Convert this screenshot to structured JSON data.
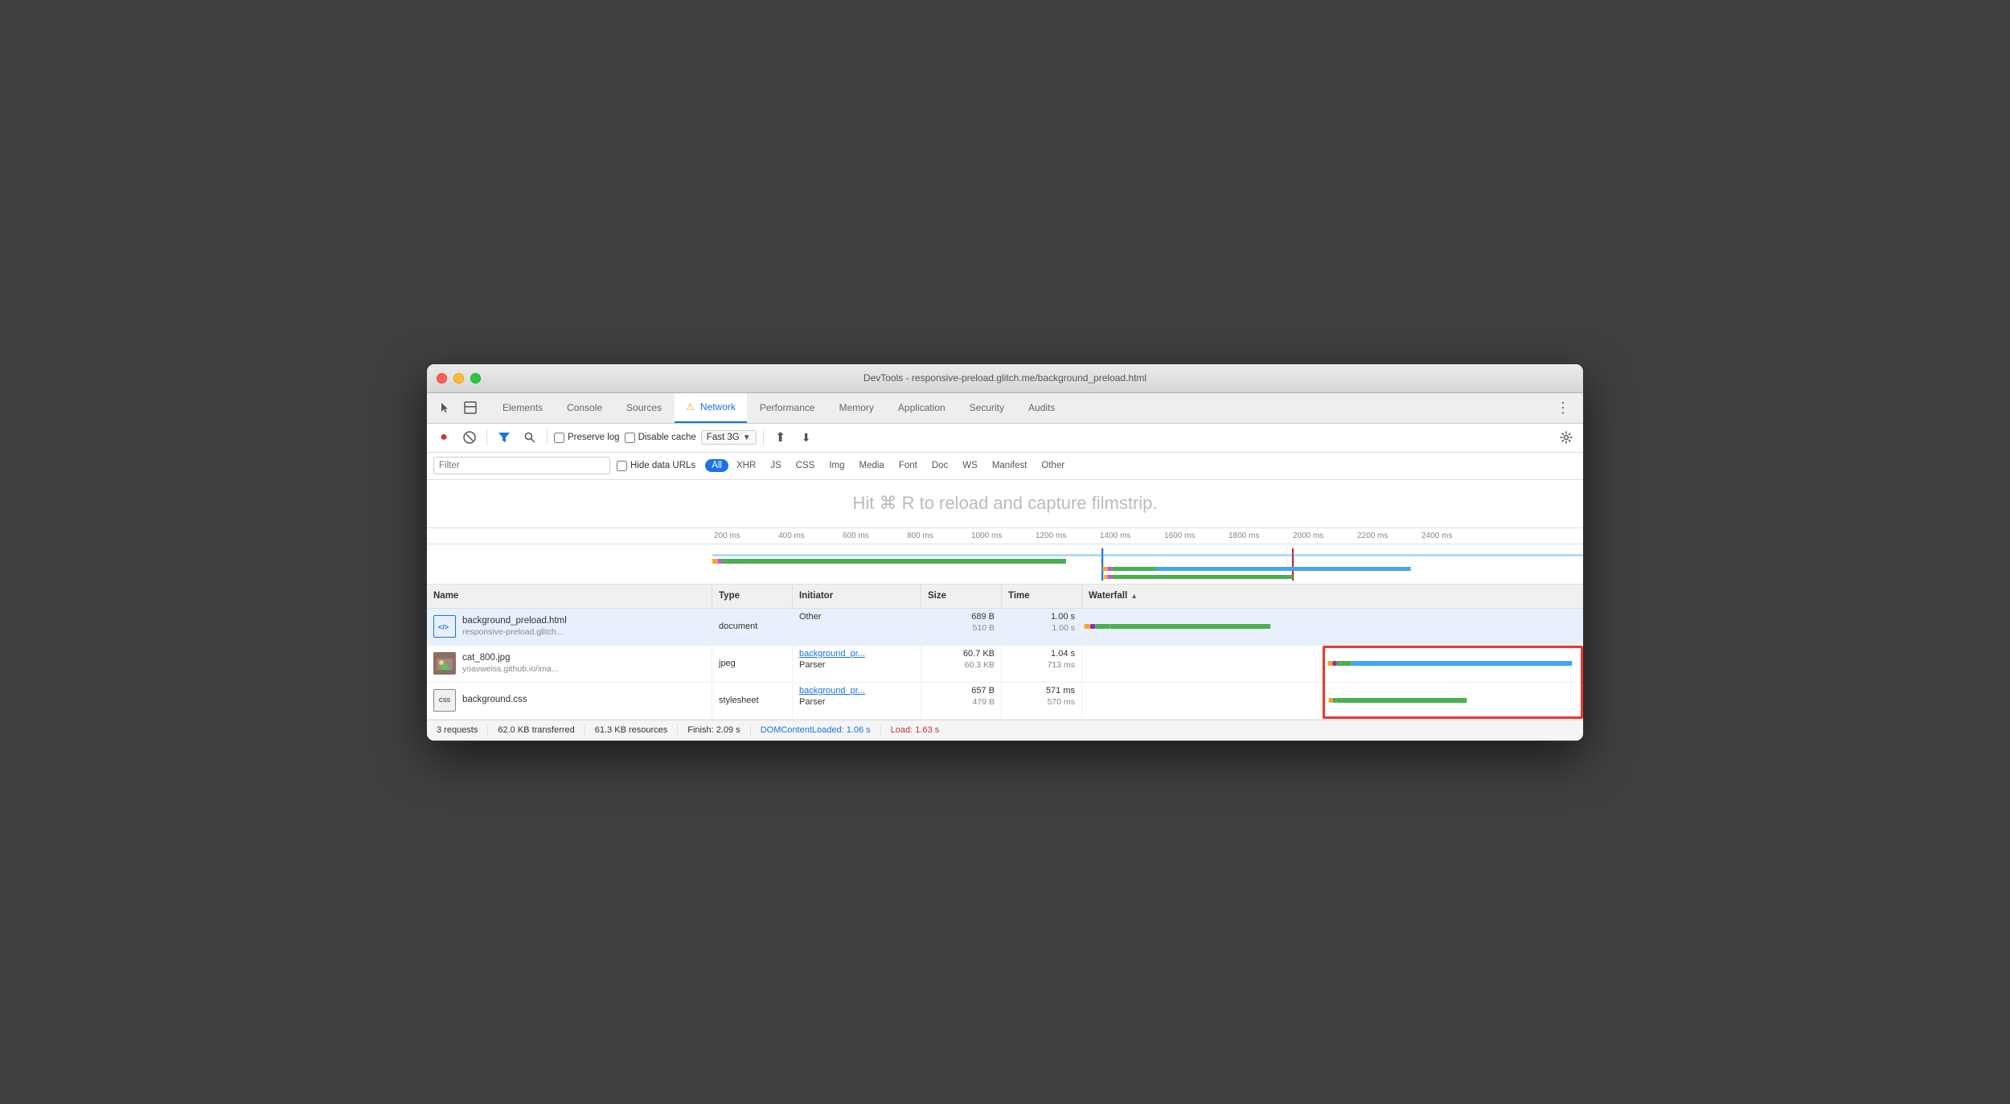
{
  "window": {
    "title": "DevTools - responsive-preload.glitch.me/background_preload.html"
  },
  "tabs": {
    "items": [
      {
        "label": "Elements",
        "active": false
      },
      {
        "label": "Console",
        "active": false
      },
      {
        "label": "Sources",
        "active": false
      },
      {
        "label": "⚠ Network",
        "active": true
      },
      {
        "label": "Performance",
        "active": false
      },
      {
        "label": "Memory",
        "active": false
      },
      {
        "label": "Application",
        "active": false
      },
      {
        "label": "Security",
        "active": false
      },
      {
        "label": "Audits",
        "active": false
      }
    ]
  },
  "toolbar": {
    "record_label": "●",
    "stop_label": "🚫",
    "filter_label": "▼",
    "search_label": "🔍",
    "preserve_log": "Preserve log",
    "disable_cache": "Disable cache",
    "throttle": "Fast 3G",
    "upload_label": "⬆",
    "download_label": "⬇",
    "settings_label": "⚙"
  },
  "filter_bar": {
    "placeholder": "Filter",
    "hide_data_urls": "Hide data URLs",
    "types": [
      "All",
      "XHR",
      "JS",
      "CSS",
      "Img",
      "Media",
      "Font",
      "Doc",
      "WS",
      "Manifest",
      "Other"
    ]
  },
  "filmstrip": {
    "message": "Hit ⌘ R to reload and capture filmstrip."
  },
  "ruler": {
    "marks": [
      "200 ms",
      "400 ms",
      "600 ms",
      "800 ms",
      "1000 ms",
      "1200 ms",
      "1400 ms",
      "1600 ms",
      "1800 ms",
      "2000 ms",
      "2200 ms",
      "2400 ms"
    ]
  },
  "table": {
    "headers": [
      "Name",
      "Type",
      "Initiator",
      "Size",
      "Time",
      "Waterfall"
    ],
    "rows": [
      {
        "name": "background_preload.html",
        "url": "responsive-preload.glitch...",
        "type": "document",
        "initiator_main": "Other",
        "initiator_sub": "",
        "size_main": "689 B",
        "size_sub": "510 B",
        "time_main": "1.00 s",
        "time_sub": "1.00 s",
        "icon_type": "html"
      },
      {
        "name": "cat_800.jpg",
        "url": "yoavweiss.github.io/ima...",
        "type": "jpeg",
        "initiator_main": "background_pr...",
        "initiator_sub": "Parser",
        "size_main": "60.7 KB",
        "size_sub": "60.3 KB",
        "time_main": "1.04 s",
        "time_sub": "713 ms",
        "icon_type": "img"
      },
      {
        "name": "background.css",
        "url": "",
        "type": "stylesheet",
        "initiator_main": "background_pr...",
        "initiator_sub": "Parser",
        "size_main": "657 B",
        "size_sub": "479 B",
        "time_main": "571 ms",
        "time_sub": "570 ms",
        "icon_type": "css"
      }
    ]
  },
  "status_bar": {
    "requests": "3 requests",
    "transferred": "62.0 KB transferred",
    "resources": "61.3 KB resources",
    "finish": "Finish: 2.09 s",
    "dom_content_loaded": "DOMContentLoaded: 1.06 s",
    "load": "Load: 1.63 s"
  }
}
